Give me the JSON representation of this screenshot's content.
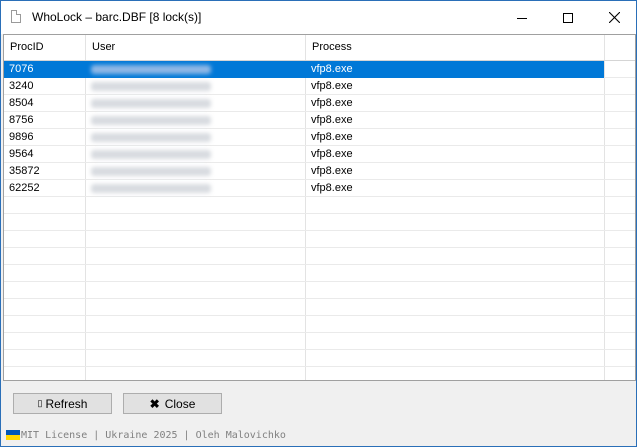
{
  "window": {
    "title": "WhoLock – barc.DBF [8 lock(s)]",
    "controls": {
      "minimize": "minimize-icon",
      "maximize": "maximize-icon",
      "close": "close-icon"
    }
  },
  "table": {
    "columns": [
      "ProcID",
      "User",
      "Process"
    ],
    "rows": [
      {
        "procid": "7076",
        "user": "",
        "process": "vfp8.exe",
        "selected": true
      },
      {
        "procid": "3240",
        "user": "",
        "process": "vfp8.exe"
      },
      {
        "procid": "8504",
        "user": "",
        "process": "vfp8.exe"
      },
      {
        "procid": "8756",
        "user": "",
        "process": "vfp8.exe"
      },
      {
        "procid": "9896",
        "user": "",
        "process": "vfp8.exe"
      },
      {
        "procid": "9564",
        "user": "",
        "process": "vfp8.exe"
      },
      {
        "procid": "35872",
        "user": "",
        "process": "vfp8.exe"
      },
      {
        "procid": "62252",
        "user": "",
        "process": "vfp8.exe"
      }
    ]
  },
  "buttons": {
    "refresh": {
      "label": "Refresh",
      "icon": "refresh-icon"
    },
    "close": {
      "label": "Close",
      "icon": "x-icon"
    }
  },
  "footer": {
    "text": "MIT License | Ukraine 2025 | Oleh Malovichko",
    "flag_colors": [
      "#0057b7",
      "#ffd700"
    ]
  },
  "colors": {
    "selection": "#0078d7",
    "title_border": "#2a6fb8"
  }
}
